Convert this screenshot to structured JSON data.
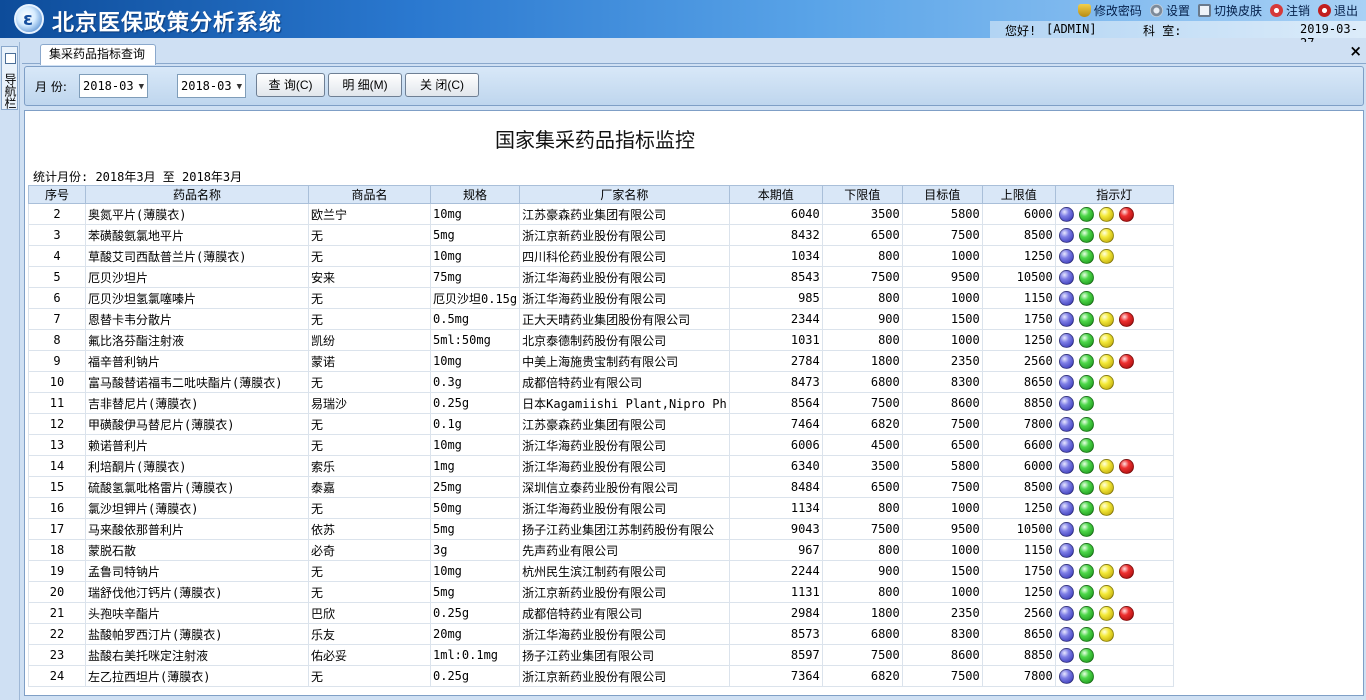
{
  "app": {
    "title": "北京医保政策分析系统"
  },
  "toplinks": [
    {
      "label": "修改密码",
      "icon": "shield-icon"
    },
    {
      "label": "设置",
      "icon": "gear-icon"
    },
    {
      "label": "切换皮肤",
      "icon": "shirt-icon"
    },
    {
      "label": "注销",
      "icon": "logoff-icon"
    },
    {
      "label": "退出",
      "icon": "power-icon"
    }
  ],
  "userbar": {
    "greeting": "您好!",
    "user": "[ADMIN]",
    "dept_label": "科 室:",
    "date": "2019-03-27"
  },
  "leftnav": {
    "label": "导航栏"
  },
  "tab": {
    "label": "集采药品指标查询",
    "close": "×"
  },
  "toolbar": {
    "month_label": "月 份:",
    "from": "2018-03",
    "to": "2018-03",
    "dash": "—",
    "query": "查 询(C)",
    "detail": "明 细(M)",
    "close": "关 闭(C)"
  },
  "report": {
    "title": "国家集采药品指标监控",
    "period": "统计月份: 2018年3月 至 2018年3月",
    "columns": [
      "序号",
      "药品名称",
      "商品名",
      "规格",
      "厂家名称",
      "本期值",
      "下限值",
      "目标值",
      "上限值",
      "指示灯"
    ],
    "rows": [
      {
        "no": "2",
        "name": "奥氮平片(薄膜衣)",
        "brand": "欧兰宁",
        "spec": "10mg",
        "maker": "江苏豪森药业集团有限公司",
        "cur": "6040",
        "low": "3500",
        "target": "5800",
        "high": "6000",
        "lamps": [
          "blue",
          "green",
          "yellow",
          "red"
        ]
      },
      {
        "no": "3",
        "name": "苯磺酸氨氯地平片",
        "brand": "无",
        "spec": "5mg",
        "maker": "浙江京新药业股份有限公司",
        "cur": "8432",
        "low": "6500",
        "target": "7500",
        "high": "8500",
        "lamps": [
          "blue",
          "green",
          "yellow"
        ]
      },
      {
        "no": "4",
        "name": "草酸艾司西酞普兰片(薄膜衣)",
        "brand": "无",
        "spec": "10mg",
        "maker": "四川科伦药业股份有限公司",
        "cur": "1034",
        "low": "800",
        "target": "1000",
        "high": "1250",
        "lamps": [
          "blue",
          "green",
          "yellow"
        ]
      },
      {
        "no": "5",
        "name": "厄贝沙坦片",
        "brand": "安来",
        "spec": "75mg",
        "maker": "浙江华海药业股份有限公司",
        "cur": "8543",
        "low": "7500",
        "target": "9500",
        "high": "10500",
        "lamps": [
          "blue",
          "green"
        ]
      },
      {
        "no": "6",
        "name": "厄贝沙坦氢氯噻嗪片",
        "brand": "无",
        "spec": "厄贝沙坦0.15g",
        "maker": "浙江华海药业股份有限公司",
        "cur": "985",
        "low": "800",
        "target": "1000",
        "high": "1150",
        "lamps": [
          "blue",
          "green"
        ]
      },
      {
        "no": "7",
        "name": "恩替卡韦分散片",
        "brand": "无",
        "spec": "0.5mg",
        "maker": "正大天晴药业集团股份有限公司",
        "cur": "2344",
        "low": "900",
        "target": "1500",
        "high": "1750",
        "lamps": [
          "blue",
          "green",
          "yellow",
          "red"
        ]
      },
      {
        "no": "8",
        "name": "氟比洛芬酯注射液",
        "brand": "凯纷",
        "spec": "5ml:50mg",
        "maker": "北京泰德制药股份有限公司",
        "cur": "1031",
        "low": "800",
        "target": "1000",
        "high": "1250",
        "lamps": [
          "blue",
          "green",
          "yellow"
        ]
      },
      {
        "no": "9",
        "name": "福辛普利钠片",
        "brand": "蒙诺",
        "spec": "10mg",
        "maker": "中美上海施贵宝制药有限公司",
        "cur": "2784",
        "low": "1800",
        "target": "2350",
        "high": "2560",
        "lamps": [
          "blue",
          "green",
          "yellow",
          "red"
        ]
      },
      {
        "no": "10",
        "name": "富马酸替诺福韦二吡呋酯片(薄膜衣)",
        "brand": "无",
        "spec": "0.3g",
        "maker": "成都倍特药业有限公司",
        "cur": "8473",
        "low": "6800",
        "target": "8300",
        "high": "8650",
        "lamps": [
          "blue",
          "green",
          "yellow"
        ]
      },
      {
        "no": "11",
        "name": "吉非替尼片(薄膜衣)",
        "brand": "易瑞沙",
        "spec": "0.25g",
        "maker": "日本Kagamiishi Plant,Nipro Ph",
        "cur": "8564",
        "low": "7500",
        "target": "8600",
        "high": "8850",
        "lamps": [
          "blue",
          "green"
        ]
      },
      {
        "no": "12",
        "name": "甲磺酸伊马替尼片(薄膜衣)",
        "brand": "无",
        "spec": "0.1g",
        "maker": "江苏豪森药业集团有限公司",
        "cur": "7464",
        "low": "6820",
        "target": "7500",
        "high": "7800",
        "lamps": [
          "blue",
          "green"
        ]
      },
      {
        "no": "13",
        "name": "赖诺普利片",
        "brand": "无",
        "spec": "10mg",
        "maker": "浙江华海药业股份有限公司",
        "cur": "6006",
        "low": "4500",
        "target": "6500",
        "high": "6600",
        "lamps": [
          "blue",
          "green"
        ]
      },
      {
        "no": "14",
        "name": "利培酮片(薄膜衣)",
        "brand": "索乐",
        "spec": "1mg",
        "maker": "浙江华海药业股份有限公司",
        "cur": "6340",
        "low": "3500",
        "target": "5800",
        "high": "6000",
        "lamps": [
          "blue",
          "green",
          "yellow",
          "red"
        ]
      },
      {
        "no": "15",
        "name": "硫酸氢氯吡格雷片(薄膜衣)",
        "brand": "泰嘉",
        "spec": "25mg",
        "maker": "深圳信立泰药业股份有限公司",
        "cur": "8484",
        "low": "6500",
        "target": "7500",
        "high": "8500",
        "lamps": [
          "blue",
          "green",
          "yellow"
        ]
      },
      {
        "no": "16",
        "name": "氯沙坦钾片(薄膜衣)",
        "brand": "无",
        "spec": "50mg",
        "maker": "浙江华海药业股份有限公司",
        "cur": "1134",
        "low": "800",
        "target": "1000",
        "high": "1250",
        "lamps": [
          "blue",
          "green",
          "yellow"
        ]
      },
      {
        "no": "17",
        "name": "马来酸依那普利片",
        "brand": "依苏",
        "spec": "5mg",
        "maker": "扬子江药业集团江苏制药股份有限公",
        "cur": "9043",
        "low": "7500",
        "target": "9500",
        "high": "10500",
        "lamps": [
          "blue",
          "green"
        ]
      },
      {
        "no": "18",
        "name": "蒙脱石散",
        "brand": "必奇",
        "spec": "3g",
        "maker": "先声药业有限公司",
        "cur": "967",
        "low": "800",
        "target": "1000",
        "high": "1150",
        "lamps": [
          "blue",
          "green"
        ]
      },
      {
        "no": "19",
        "name": "孟鲁司特钠片",
        "brand": "无",
        "spec": "10mg",
        "maker": "杭州民生滨江制药有限公司",
        "cur": "2244",
        "low": "900",
        "target": "1500",
        "high": "1750",
        "lamps": [
          "blue",
          "green",
          "yellow",
          "red"
        ]
      },
      {
        "no": "20",
        "name": "瑞舒伐他汀钙片(薄膜衣)",
        "brand": "无",
        "spec": "5mg",
        "maker": "浙江京新药业股份有限公司",
        "cur": "1131",
        "low": "800",
        "target": "1000",
        "high": "1250",
        "lamps": [
          "blue",
          "green",
          "yellow"
        ]
      },
      {
        "no": "21",
        "name": "头孢呋辛酯片",
        "brand": "巴欣",
        "spec": "0.25g",
        "maker": "成都倍特药业有限公司",
        "cur": "2984",
        "low": "1800",
        "target": "2350",
        "high": "2560",
        "lamps": [
          "blue",
          "green",
          "yellow",
          "red"
        ]
      },
      {
        "no": "22",
        "name": "盐酸帕罗西汀片(薄膜衣)",
        "brand": "乐友",
        "spec": "20mg",
        "maker": "浙江华海药业股份有限公司",
        "cur": "8573",
        "low": "6800",
        "target": "8300",
        "high": "8650",
        "lamps": [
          "blue",
          "green",
          "yellow"
        ]
      },
      {
        "no": "23",
        "name": "盐酸右美托咪定注射液",
        "brand": "佑必妥",
        "spec": "1ml:0.1mg",
        "maker": "扬子江药业集团有限公司",
        "cur": "8597",
        "low": "7500",
        "target": "8600",
        "high": "8850",
        "lamps": [
          "blue",
          "green"
        ]
      },
      {
        "no": "24",
        "name": "左乙拉西坦片(薄膜衣)",
        "brand": "无",
        "spec": "0.25g",
        "maker": "浙江京新药业股份有限公司",
        "cur": "7364",
        "low": "6820",
        "target": "7500",
        "high": "7800",
        "lamps": [
          "blue",
          "green"
        ]
      }
    ]
  }
}
